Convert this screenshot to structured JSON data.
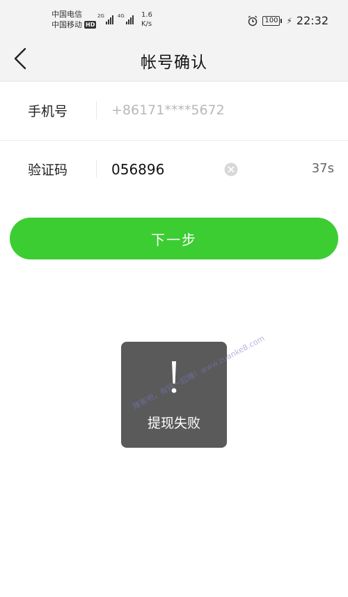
{
  "status_bar": {
    "carrier_1": "中国电信",
    "carrier_2": "中国移动",
    "hd_badge": "HD",
    "network_1": "2G",
    "network_2": "4G",
    "speed_value": "1.6",
    "speed_unit": "K/s",
    "battery": "100",
    "time": "22:32",
    "icons": [
      "alarm-icon",
      "battery-icon",
      "charging-icon",
      "signal-icon"
    ]
  },
  "header": {
    "title": "帐号确认",
    "back_icon": "chevron-left-icon"
  },
  "form": {
    "phone_label": "手机号",
    "phone_value": "+86171****5672",
    "code_label": "验证码",
    "code_value": "056896",
    "countdown": "37s",
    "clear_icon": "clear-circle-icon"
  },
  "actions": {
    "next_label": "下一步"
  },
  "toast": {
    "message": "提现失败",
    "icon": "exclamation-icon",
    "watermark": "赚客吧，有钱一起赚！www.zuanke8.com"
  },
  "colors": {
    "primary_green": "#3ccd33",
    "toast_bg": "#5a5a5a",
    "header_bg": "#f3f3f3"
  }
}
